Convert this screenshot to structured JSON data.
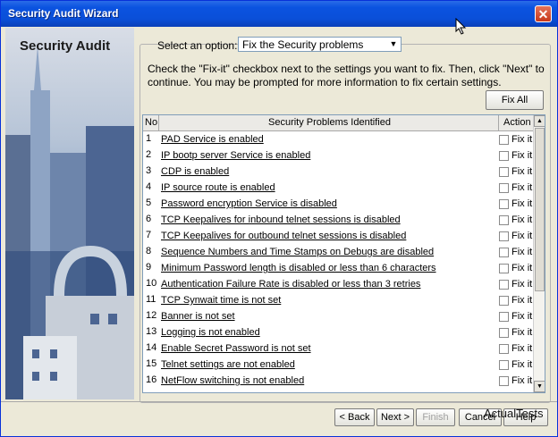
{
  "window": {
    "title": "Security Audit Wizard"
  },
  "sidebar": {
    "title": "Security Audit"
  },
  "option": {
    "label": "Select an option:",
    "value": "Fix the Security problems"
  },
  "instructions": "Check the \"Fix-it\" checkbox next to the settings you want to fix. Then, click \"Next\" to continue. You may be prompted for more information to fix certain settings.",
  "buttons": {
    "fix_all": "Fix All",
    "back": "< Back",
    "next": "Next >",
    "finish": "Finish",
    "cancel": "Cancel",
    "help": "Help"
  },
  "table": {
    "headers": {
      "no": "No",
      "problem": "Security Problems Identified",
      "action": "Action"
    },
    "action_label": "Fix it",
    "rows": [
      {
        "no": "1",
        "problem": "PAD Service is enabled"
      },
      {
        "no": "2",
        "problem": "IP bootp server Service is enabled"
      },
      {
        "no": "3",
        "problem": "CDP is enabled"
      },
      {
        "no": "4",
        "problem": "IP source route is enabled"
      },
      {
        "no": "5",
        "problem": "Password encryption Service is disabled"
      },
      {
        "no": "6",
        "problem": "TCP Keepalives for inbound telnet sessions is disabled"
      },
      {
        "no": "7",
        "problem": "TCP Keepalives for outbound telnet sessions is disabled"
      },
      {
        "no": "8",
        "problem": "Sequence Numbers and Time Stamps on Debugs are disabled"
      },
      {
        "no": "9",
        "problem": "Minimum Password length is disabled or less than 6 characters"
      },
      {
        "no": "10",
        "problem": "Authentication Failure Rate is disabled or less than 3 retries"
      },
      {
        "no": "11",
        "problem": "TCP Synwait time is not set"
      },
      {
        "no": "12",
        "problem": "Banner is not set"
      },
      {
        "no": "13",
        "problem": "Logging is not enabled"
      },
      {
        "no": "14",
        "problem": "Enable Secret Password is not set"
      },
      {
        "no": "15",
        "problem": "Telnet settings are not enabled"
      },
      {
        "no": "16",
        "problem": "NetFlow switching is not enabled"
      }
    ]
  },
  "watermark": "ActualTests"
}
